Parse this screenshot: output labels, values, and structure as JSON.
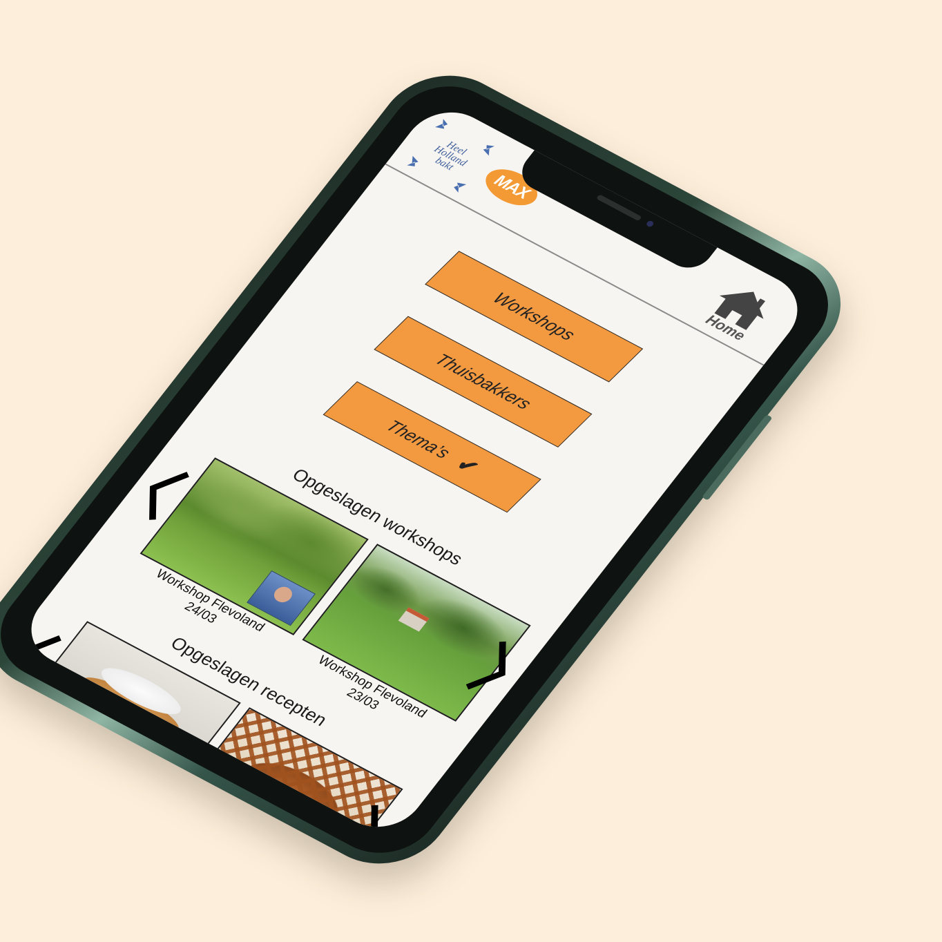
{
  "header": {
    "logo_text": "Heel\nHolland\nbakt",
    "max_logo_text": "MAX",
    "home_label": "Home",
    "home_icon": "home-icon"
  },
  "menu": {
    "workshops_label": "Workshops",
    "thuisbakkers_label": "Thuisbakkers",
    "themas_label": "Thema’s",
    "themas_selected_icon": "checkmark-icon"
  },
  "saved_workshops": {
    "title": "Opgeslagen workshops",
    "items": [
      {
        "title": "Workshop Flevoland",
        "date": "24/03"
      },
      {
        "title": "Workshop Flevoland",
        "date": "23/03"
      }
    ]
  },
  "saved_recipes": {
    "title": "Opgeslagen recepten"
  },
  "colors": {
    "background": "#fdeedb",
    "button_orange": "#f39a40",
    "screen": "#f7f5f1",
    "phone_green": "#2c463a"
  }
}
